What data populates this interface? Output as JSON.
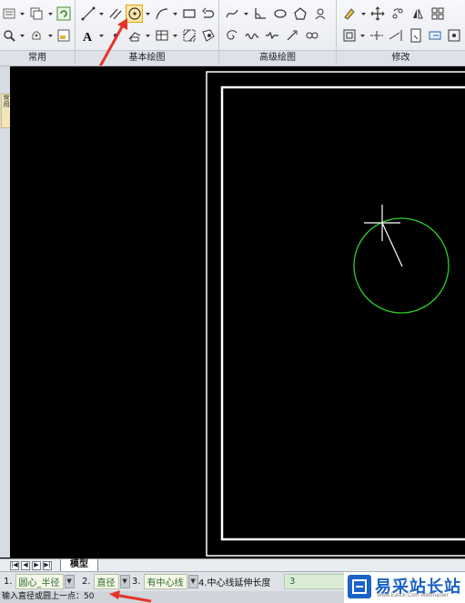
{
  "ribbon": {
    "panels": [
      {
        "title": "常用"
      },
      {
        "title": "基本绘图"
      },
      {
        "title": "高级绘图"
      },
      {
        "title": "修改"
      }
    ]
  },
  "left_tab": {
    "label": "常用"
  },
  "tabs": {
    "model_label": "模型"
  },
  "command_options": {
    "opt1_num": "1.",
    "opt1_value": "圆心_半径",
    "opt2_num": "2.",
    "opt2_value": "直径",
    "opt3_num": "3.",
    "opt3_value": "有中心线",
    "opt4_label": "4.中心线延伸长度",
    "opt4_value": "3"
  },
  "status": {
    "prompt": "输入直径或圆上一点：50"
  },
  "watermark": {
    "text": "易采站长站",
    "sub": "Www.Easck.Com  Webmaster"
  },
  "colors": {
    "circle": "#2bd02b",
    "accent_arrow": "#e6332a",
    "highlight": "#fbe6a4"
  }
}
